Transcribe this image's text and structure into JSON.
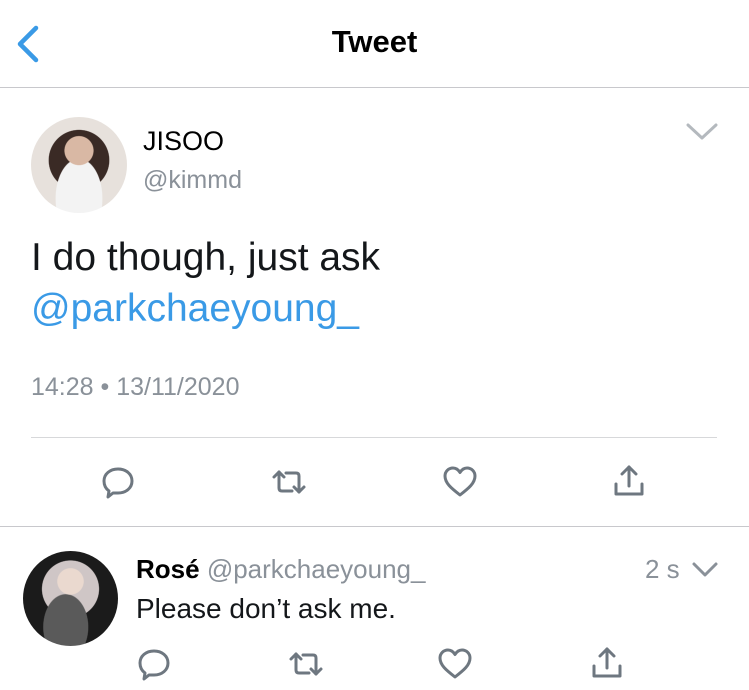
{
  "nav": {
    "title": "Tweet",
    "back_icon": "chevron-left-icon"
  },
  "tweet": {
    "name": "JISOO",
    "handle": "@kimmd",
    "text": "I do though, just ask",
    "mention": "@parkchaeyoung_",
    "timestamp": "14:28 • 13/11/2020",
    "actions": [
      "reply-icon",
      "retweet-icon",
      "like-icon",
      "share-icon"
    ]
  },
  "reply": {
    "name": "Rosé",
    "handle": "@parkchaeyoung_",
    "time": "2 s",
    "text": "Please don’t ask me.",
    "actions": [
      "reply-icon",
      "retweet-icon",
      "like-icon",
      "share-icon"
    ]
  },
  "colors": {
    "accent": "#3a9ae6",
    "secondary_text": "#8a9199",
    "primary_text": "#14171a",
    "icon_gray": "#6e7780"
  }
}
